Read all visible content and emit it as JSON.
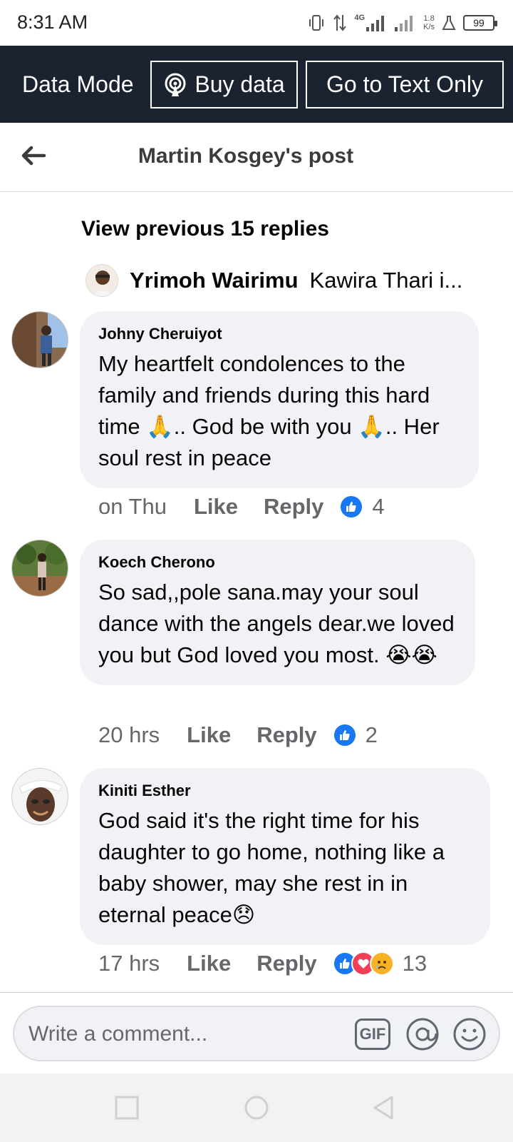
{
  "status_bar": {
    "time": "8:31 AM",
    "network": "4G",
    "speed_value": "1.8",
    "speed_unit": "K/s",
    "battery": "99"
  },
  "data_bar": {
    "mode_label": "Data Mode",
    "buy_data_label": "Buy data",
    "text_only_label": "Go to Text Only"
  },
  "header": {
    "title": "Martin Kosgey's post"
  },
  "thread": {
    "view_previous_label": "View previous 15 replies",
    "reply_preview": {
      "author": "Yrimoh Wairimu",
      "snippet": "Kawira Thari i..."
    }
  },
  "comments": [
    {
      "author": "Johny Cheruiyot",
      "text": "My heartfelt condolences to the family and friends during this hard time 🙏.. God be with you 🙏.. Her soul rest in peace",
      "time": "on Thu",
      "like_label": "Like",
      "reply_label": "Reply",
      "reaction_count": "4"
    },
    {
      "author": "Koech Cherono",
      "text": "So sad,,pole sana.may your soul dance with the angels dear.we loved you but God loved you most. 😭😭",
      "time": "20 hrs",
      "like_label": "Like",
      "reply_label": "Reply",
      "reaction_count": "2"
    },
    {
      "author": "Kiniti Esther",
      "text": "God said it's the right time for his daughter to go home, nothing like  a baby shower, may she rest in in eternal peace😞",
      "time": "17 hrs",
      "like_label": "Like",
      "reply_label": "Reply",
      "reaction_count": "13"
    }
  ],
  "composer": {
    "placeholder": "Write a comment...",
    "gif_label": "GIF"
  },
  "colors": {
    "data_bar_bg": "#1c2330",
    "bubble_bg": "#f0f2f5",
    "like_blue": "#1877f2",
    "love_red": "#f33e58",
    "sad_yellow": "#f7b125",
    "meta_gray": "#65676b"
  }
}
